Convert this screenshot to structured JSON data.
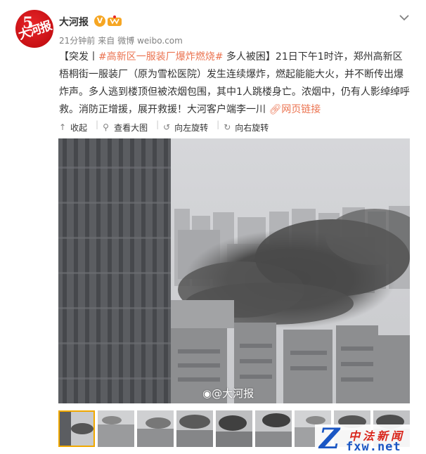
{
  "user": {
    "name": "大河报",
    "verified_icon": "verified-v-icon",
    "member_icon": "member-crown-icon",
    "avatar_text": "大河报",
    "avatar_number": "5"
  },
  "meta": {
    "time": "21分钟前",
    "source_prefix": "来自",
    "source": "微博 weibo.com"
  },
  "post": {
    "bracket_open": "【突发丨",
    "hashtag": "#高新区一服装厂爆炸燃烧#",
    "headline_rest": " 多人被困】",
    "body": "21日下午1时许，郑州高新区梧桐街一服装厂（原为雪松医院）发生连续爆炸，燃起能能大火，并不断传出爆炸声。多人逃到楼顶但被浓烟包围，其中1人跳楼身亡。浓烟中，仍有人影绰绰呼救。消防正增援，展开救援！大河客户端李一川",
    "link_icon": "link-icon",
    "link_label": "网页链接"
  },
  "actions": [
    {
      "icon": "collapse-icon",
      "label": "收起"
    },
    {
      "icon": "magnify-icon",
      "label": "查看大图"
    },
    {
      "icon": "rotate-left-icon",
      "label": "向左旋转"
    },
    {
      "icon": "rotate-right-icon",
      "label": "向右旋转"
    }
  ],
  "photo": {
    "watermark": "@大河报"
  },
  "thumbnail_count": 9,
  "active_thumbnail": 1,
  "site_logo": {
    "letter": "Z",
    "cn": "中法新闻",
    "url": "fxw.net"
  },
  "colors": {
    "accent": "#eb7350",
    "link_blue": "#1a56c4",
    "brand_red": "#d9261c",
    "active_thumb_border": "#f0a800",
    "smoke": "#4a4a4a"
  }
}
